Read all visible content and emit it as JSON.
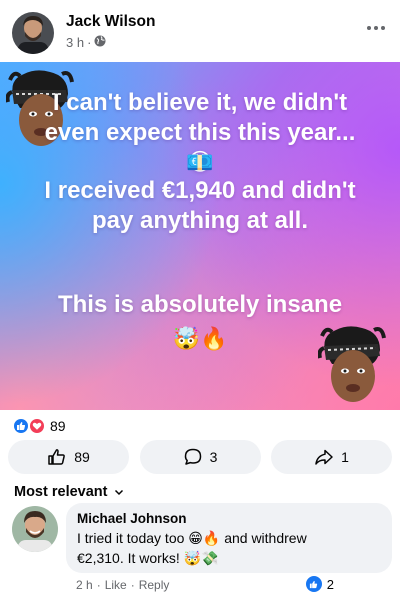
{
  "post": {
    "author": "Jack Wilson",
    "time": "3 h",
    "separator": "·",
    "audience_icon": "globe-icon",
    "more_icon": "more-horizontal-icon",
    "lines": {
      "line1": "I can't believe it, we didn't even expect this this year... 😳",
      "money_emoji": "💶",
      "line2": "I received €1,940 and didn't pay anything at all.",
      "line3": "This is absolutely insane",
      "emoji_end": "🤯🔥"
    },
    "background_colors": [
      "#5fa8ff",
      "#a77ce8",
      "#d58ad8",
      "#ff9eb5"
    ]
  },
  "reactions": {
    "count": "89",
    "icons": [
      "like-reaction-icon",
      "love-reaction-icon"
    ],
    "like_color": "#1877f2",
    "love_color": "#f33e58"
  },
  "actions": {
    "like_count": "89",
    "comment_count": "3",
    "share_count": "1"
  },
  "comments": {
    "sort_label": "Most relevant",
    "items": [
      {
        "name": "Michael Johnson",
        "text_line1": "I tried it today too 😁🔥 and withdrew",
        "text_line2": "€2,310. It works! 🤯💸",
        "time": "2 h",
        "dot": "·",
        "like_label": "Like",
        "reply_label": "Reply",
        "reaction_count": "2"
      }
    ]
  },
  "accent_color": "#1877f2"
}
